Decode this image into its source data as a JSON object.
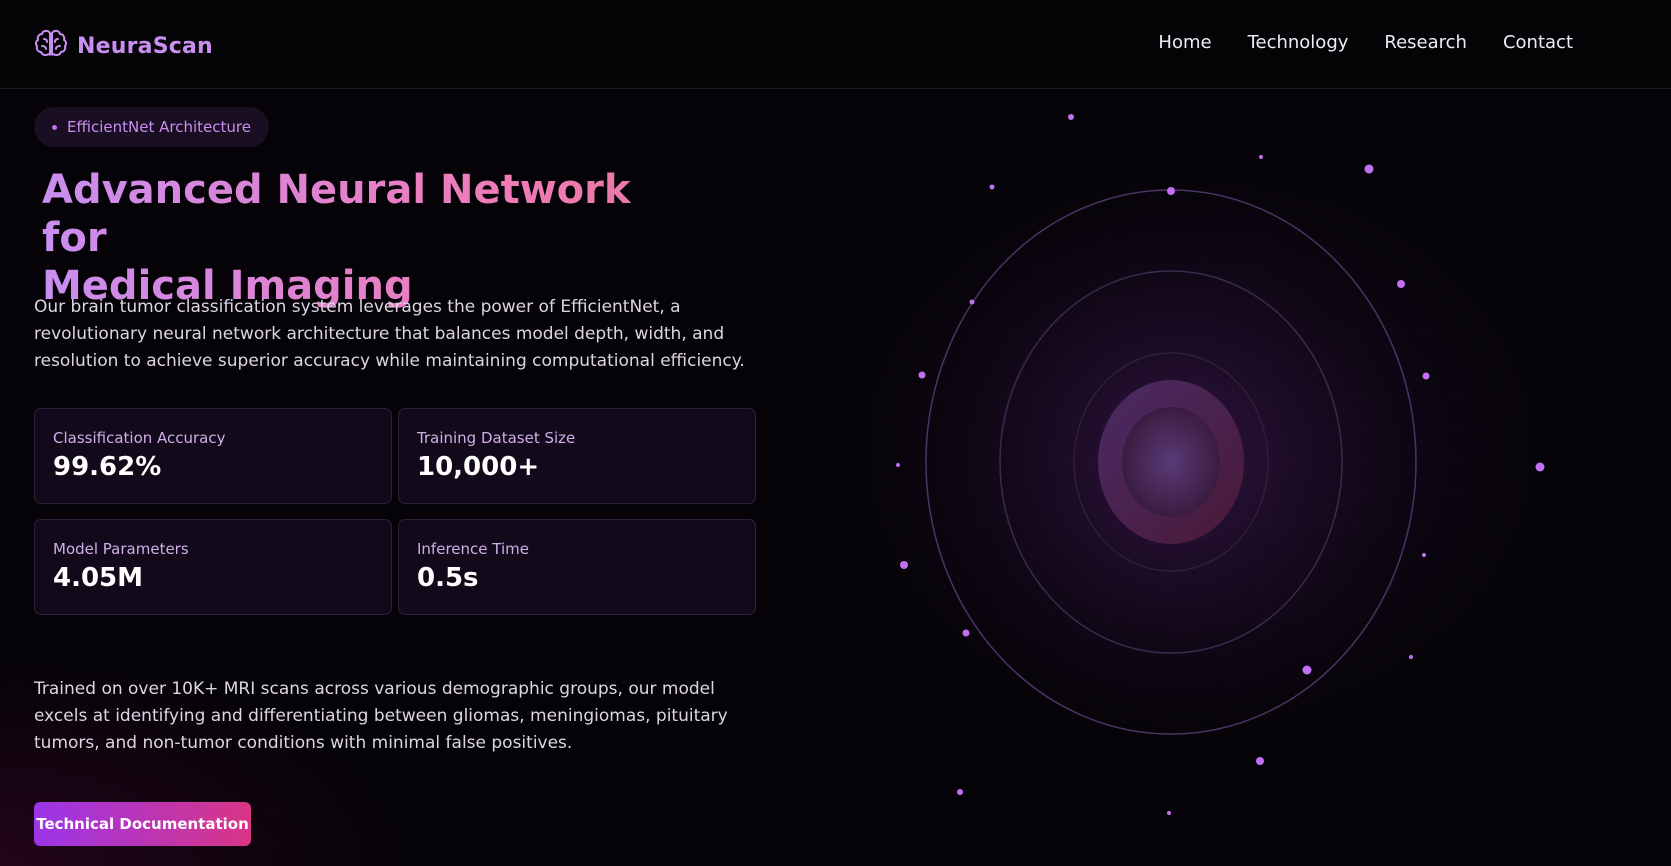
{
  "brand": {
    "name": "NeuraScan",
    "logo_icon": "brain-icon"
  },
  "nav": [
    {
      "label": "Home"
    },
    {
      "label": "Technology"
    },
    {
      "label": "Research"
    },
    {
      "label": "Contact"
    }
  ],
  "hero": {
    "badge": "EfficientNet Architecture",
    "title_line1": "Advanced Neural Network for",
    "title_line2": "Medical Imaging",
    "description": "Our brain tumor classification system leverages the power of EfficientNet, a revolutionary neural network architecture that balances model depth, width, and resolution to achieve superior accuracy while maintaining computational efficiency.",
    "stats": [
      {
        "label": "Classification Accuracy",
        "value": "99.62%"
      },
      {
        "label": "Training Dataset Size",
        "value": "10,000+"
      },
      {
        "label": "Model Parameters",
        "value": "4.05M"
      },
      {
        "label": "Inference Time",
        "value": "0.5s"
      }
    ],
    "details": "Trained on over 10K+ MRI scans across various demographic groups, our model excels at identifying and differentiating between gliomas, meningiomas, pituitary tumors, and non-tumor conditions with minimal false positives.",
    "cta_label": "Technical Documentation"
  },
  "colors": {
    "accent_purple": "#c98ef0",
    "accent_pink": "#f07ab8",
    "background": "#050307",
    "card_bg": "#12091a",
    "button_start": "#9b35e8",
    "button_end": "#d93585"
  }
}
